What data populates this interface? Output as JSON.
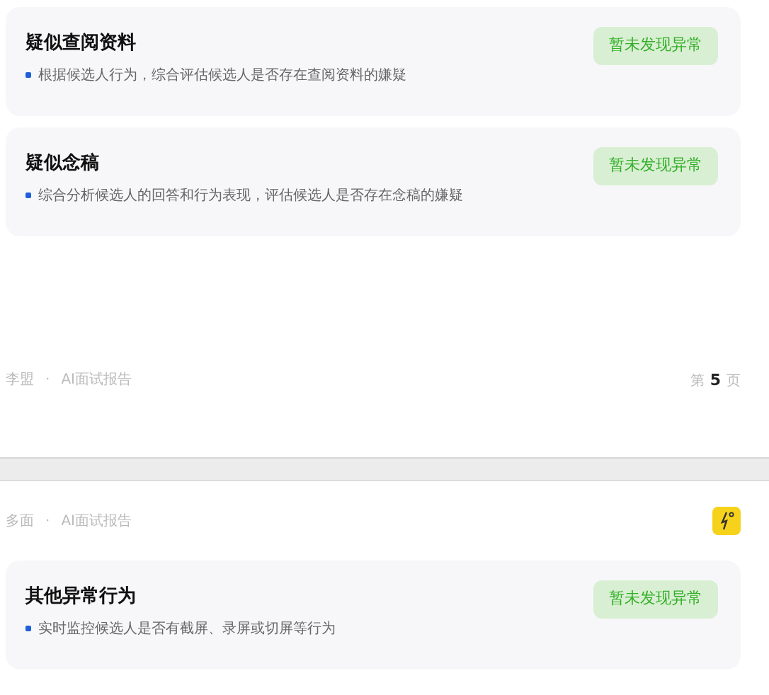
{
  "pages": [
    {
      "cards": [
        {
          "title": "疑似查阅资料",
          "description": "根据候选人行为，综合评估候选人是否存在查阅资料的嫌疑",
          "status": "暂未发现异常"
        },
        {
          "title": "疑似念稿",
          "description": "综合分析候选人的回答和行为表现，评估候选人是否存在念稿的嫌疑",
          "status": "暂未发现异常"
        }
      ],
      "footer": {
        "name": "李盟",
        "separator": "·",
        "report": "AI面试报告",
        "page_prefix": "第",
        "page_number": "5",
        "page_suffix": "页"
      }
    },
    {
      "header": {
        "name": "多面",
        "separator": "·",
        "report": "AI面试报告"
      },
      "cards": [
        {
          "title": "其他异常行为",
          "description": "实时监控候选人是否有截屏、录屏或切屏等行为",
          "status": "暂未发现异常"
        }
      ]
    }
  ]
}
